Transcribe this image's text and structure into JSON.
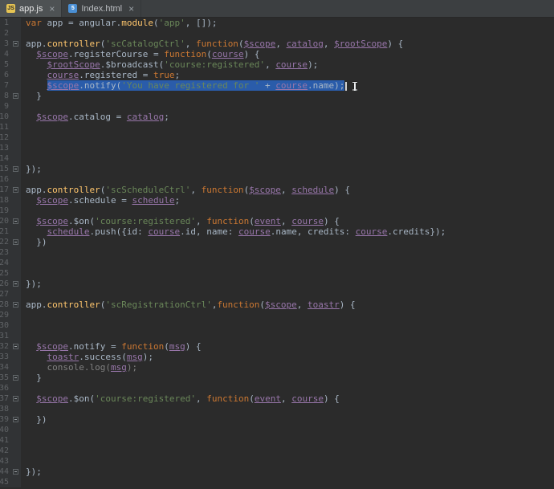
{
  "tabs": [
    {
      "label": "app.js",
      "icon_text": "JS",
      "close_label": "×",
      "active": true
    },
    {
      "label": "Index.html",
      "icon_text": "5",
      "close_label": "×",
      "active": false
    }
  ],
  "colors": {
    "editor_bg": "#2b2b2b",
    "gutter_bg": "#313335",
    "tab_bar_bg": "#3c3f41",
    "active_tab_bg": "#4e5254",
    "selection": "#2a5caa",
    "keyword": "#cc7832",
    "string": "#6a8759",
    "function_name": "#ffc66d",
    "parameter": "#9876aa",
    "default_text": "#a9b7c6",
    "dimmed": "#808080",
    "line_number": "#606366",
    "caret": "#d4d4d4"
  },
  "editor": {
    "file_name": "app.js",
    "lines": [
      {
        "num": 1,
        "fold": false,
        "segments": [
          {
            "c": "kw",
            "t": "var"
          },
          {
            "c": "d",
            "t": " app = angular."
          },
          {
            "c": "fn",
            "t": "module"
          },
          {
            "c": "d",
            "t": "("
          },
          {
            "c": "str",
            "t": "'app'"
          },
          {
            "c": "d",
            "t": ", []);"
          }
        ]
      },
      {
        "num": 2,
        "fold": false,
        "segments": []
      },
      {
        "num": 3,
        "fold": true,
        "segments": [
          {
            "c": "d",
            "t": "app."
          },
          {
            "c": "fn",
            "t": "controller"
          },
          {
            "c": "d",
            "t": "("
          },
          {
            "c": "str",
            "t": "'scCatalogCtrl'"
          },
          {
            "c": "d",
            "t": ", "
          },
          {
            "c": "kw",
            "t": "function"
          },
          {
            "c": "d",
            "t": "("
          },
          {
            "c": "pu",
            "t": "$scope"
          },
          {
            "c": "d",
            "t": ", "
          },
          {
            "c": "pu",
            "t": "catalog"
          },
          {
            "c": "d",
            "t": ", "
          },
          {
            "c": "pu",
            "t": "$rootScope"
          },
          {
            "c": "d",
            "t": ") {"
          }
        ]
      },
      {
        "num": 4,
        "fold": false,
        "segments": [
          {
            "c": "d",
            "t": "  "
          },
          {
            "c": "pu",
            "t": "$scope"
          },
          {
            "c": "d",
            "t": ".registerCourse = "
          },
          {
            "c": "kw",
            "t": "function"
          },
          {
            "c": "d",
            "t": "("
          },
          {
            "c": "pu",
            "t": "course"
          },
          {
            "c": "d",
            "t": ") {"
          }
        ]
      },
      {
        "num": 5,
        "fold": false,
        "segments": [
          {
            "c": "d",
            "t": "    "
          },
          {
            "c": "pu",
            "t": "$rootScope"
          },
          {
            "c": "d",
            "t": ".$broadcast("
          },
          {
            "c": "str",
            "t": "'course:registered'"
          },
          {
            "c": "d",
            "t": ", "
          },
          {
            "c": "pu",
            "t": "course"
          },
          {
            "c": "d",
            "t": ");"
          }
        ]
      },
      {
        "num": 6,
        "fold": false,
        "segments": [
          {
            "c": "d",
            "t": "    "
          },
          {
            "c": "pu",
            "t": "course"
          },
          {
            "c": "d",
            "t": ".registered = "
          },
          {
            "c": "kw",
            "t": "true"
          },
          {
            "c": "d",
            "t": ";"
          }
        ]
      },
      {
        "num": 7,
        "fold": false,
        "selected": true,
        "indent": "    ",
        "segments": [
          {
            "c": "pu",
            "t": "$scope"
          },
          {
            "c": "d",
            "t": ".notify("
          },
          {
            "c": "str",
            "t": "'You have registered for '"
          },
          {
            "c": "d",
            "t": " + "
          },
          {
            "c": "pu",
            "t": "course"
          },
          {
            "c": "d",
            "t": ".name);"
          }
        ]
      },
      {
        "num": 8,
        "fold": true,
        "segments": [
          {
            "c": "d",
            "t": "  }"
          }
        ]
      },
      {
        "num": 9,
        "fold": false,
        "segments": []
      },
      {
        "num": 10,
        "fold": false,
        "segments": [
          {
            "c": "d",
            "t": "  "
          },
          {
            "c": "pu",
            "t": "$scope"
          },
          {
            "c": "d",
            "t": ".catalog = "
          },
          {
            "c": "pu",
            "t": "catalog"
          },
          {
            "c": "d",
            "t": ";"
          }
        ]
      },
      {
        "num": 11,
        "fold": false,
        "segments": []
      },
      {
        "num": 12,
        "fold": false,
        "segments": []
      },
      {
        "num": 13,
        "fold": false,
        "segments": []
      },
      {
        "num": 14,
        "fold": false,
        "segments": []
      },
      {
        "num": 15,
        "fold": true,
        "segments": [
          {
            "c": "d",
            "t": "});"
          }
        ]
      },
      {
        "num": 16,
        "fold": false,
        "segments": []
      },
      {
        "num": 17,
        "fold": true,
        "segments": [
          {
            "c": "d",
            "t": "app."
          },
          {
            "c": "fn",
            "t": "controller"
          },
          {
            "c": "d",
            "t": "("
          },
          {
            "c": "str",
            "t": "'scScheduleCtrl'"
          },
          {
            "c": "d",
            "t": ", "
          },
          {
            "c": "kw",
            "t": "function"
          },
          {
            "c": "d",
            "t": "("
          },
          {
            "c": "pu",
            "t": "$scope"
          },
          {
            "c": "d",
            "t": ", "
          },
          {
            "c": "pu",
            "t": "schedule"
          },
          {
            "c": "d",
            "t": ") {"
          }
        ]
      },
      {
        "num": 18,
        "fold": false,
        "segments": [
          {
            "c": "d",
            "t": "  "
          },
          {
            "c": "pu",
            "t": "$scope"
          },
          {
            "c": "d",
            "t": ".schedule = "
          },
          {
            "c": "pu",
            "t": "schedule"
          },
          {
            "c": "d",
            "t": ";"
          }
        ]
      },
      {
        "num": 19,
        "fold": false,
        "segments": []
      },
      {
        "num": 20,
        "fold": true,
        "segments": [
          {
            "c": "d",
            "t": "  "
          },
          {
            "c": "pu",
            "t": "$scope"
          },
          {
            "c": "d",
            "t": ".$on("
          },
          {
            "c": "str",
            "t": "'course:registered'"
          },
          {
            "c": "d",
            "t": ", "
          },
          {
            "c": "kw",
            "t": "function"
          },
          {
            "c": "d",
            "t": "("
          },
          {
            "c": "pu",
            "t": "event"
          },
          {
            "c": "d",
            "t": ", "
          },
          {
            "c": "pu",
            "t": "course"
          },
          {
            "c": "d",
            "t": ") {"
          }
        ]
      },
      {
        "num": 21,
        "fold": false,
        "segments": [
          {
            "c": "d",
            "t": "    "
          },
          {
            "c": "pu",
            "t": "schedule"
          },
          {
            "c": "d",
            "t": ".push({id: "
          },
          {
            "c": "pu",
            "t": "course"
          },
          {
            "c": "d",
            "t": ".id, name: "
          },
          {
            "c": "pu",
            "t": "course"
          },
          {
            "c": "d",
            "t": ".name, credits: "
          },
          {
            "c": "pu",
            "t": "course"
          },
          {
            "c": "d",
            "t": ".credits});"
          }
        ]
      },
      {
        "num": 22,
        "fold": true,
        "segments": [
          {
            "c": "d",
            "t": "  })"
          }
        ]
      },
      {
        "num": 23,
        "fold": false,
        "segments": []
      },
      {
        "num": 24,
        "fold": false,
        "segments": []
      },
      {
        "num": 25,
        "fold": false,
        "segments": []
      },
      {
        "num": 26,
        "fold": true,
        "segments": [
          {
            "c": "d",
            "t": "});"
          }
        ]
      },
      {
        "num": 27,
        "fold": false,
        "segments": []
      },
      {
        "num": 28,
        "fold": true,
        "segments": [
          {
            "c": "d",
            "t": "app."
          },
          {
            "c": "fn",
            "t": "controller"
          },
          {
            "c": "d",
            "t": "("
          },
          {
            "c": "str",
            "t": "'scRegistrationCtrl'"
          },
          {
            "c": "d",
            "t": ","
          },
          {
            "c": "kw",
            "t": "function"
          },
          {
            "c": "d",
            "t": "("
          },
          {
            "c": "pu",
            "t": "$scope"
          },
          {
            "c": "d",
            "t": ", "
          },
          {
            "c": "pu",
            "t": "toastr"
          },
          {
            "c": "d",
            "t": ") {"
          }
        ]
      },
      {
        "num": 29,
        "fold": false,
        "segments": []
      },
      {
        "num": 30,
        "fold": false,
        "segments": []
      },
      {
        "num": 31,
        "fold": false,
        "segments": []
      },
      {
        "num": 32,
        "fold": true,
        "segments": [
          {
            "c": "d",
            "t": "  "
          },
          {
            "c": "pu",
            "t": "$scope"
          },
          {
            "c": "d",
            "t": ".notify = "
          },
          {
            "c": "kw",
            "t": "function"
          },
          {
            "c": "d",
            "t": "("
          },
          {
            "c": "pu",
            "t": "msg"
          },
          {
            "c": "d",
            "t": ") {"
          }
        ]
      },
      {
        "num": 33,
        "fold": false,
        "segments": [
          {
            "c": "d",
            "t": "    "
          },
          {
            "c": "pu",
            "t": "toastr"
          },
          {
            "c": "d",
            "t": ".success("
          },
          {
            "c": "pu",
            "t": "msg"
          },
          {
            "c": "d",
            "t": ");"
          }
        ]
      },
      {
        "num": 34,
        "fold": false,
        "segments": [
          {
            "c": "dim",
            "t": "    console.log("
          },
          {
            "c": "pu",
            "t": "msg"
          },
          {
            "c": "dim",
            "t": ");"
          }
        ]
      },
      {
        "num": 35,
        "fold": true,
        "segments": [
          {
            "c": "d",
            "t": "  }"
          }
        ]
      },
      {
        "num": 36,
        "fold": false,
        "segments": []
      },
      {
        "num": 37,
        "fold": true,
        "segments": [
          {
            "c": "d",
            "t": "  "
          },
          {
            "c": "pu",
            "t": "$scope"
          },
          {
            "c": "d",
            "t": ".$on("
          },
          {
            "c": "str",
            "t": "'course:registered'"
          },
          {
            "c": "d",
            "t": ", "
          },
          {
            "c": "kw",
            "t": "function"
          },
          {
            "c": "d",
            "t": "("
          },
          {
            "c": "pu",
            "t": "event"
          },
          {
            "c": "d",
            "t": ", "
          },
          {
            "c": "pu",
            "t": "course"
          },
          {
            "c": "d",
            "t": ") {"
          }
        ]
      },
      {
        "num": 38,
        "fold": false,
        "segments": []
      },
      {
        "num": 39,
        "fold": true,
        "segments": [
          {
            "c": "d",
            "t": "  })"
          }
        ]
      },
      {
        "num": 40,
        "fold": false,
        "segments": []
      },
      {
        "num": 41,
        "fold": false,
        "segments": []
      },
      {
        "num": 42,
        "fold": false,
        "segments": []
      },
      {
        "num": 43,
        "fold": false,
        "segments": []
      },
      {
        "num": 44,
        "fold": true,
        "segments": [
          {
            "c": "d",
            "t": "});"
          }
        ]
      },
      {
        "num": 45,
        "fold": false,
        "segments": []
      }
    ]
  }
}
